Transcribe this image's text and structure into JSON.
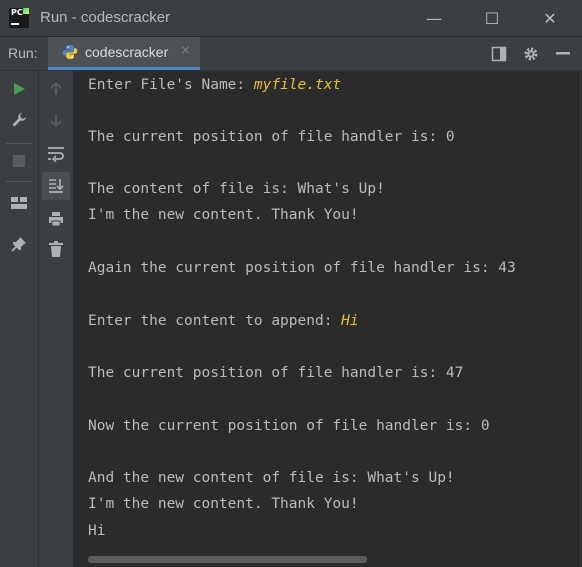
{
  "window": {
    "title": "Run - codescracker",
    "minimize": "—",
    "maximize": "☐",
    "close": "✕"
  },
  "runbar": {
    "label": "Run:",
    "tab_label": "codescracker",
    "tab_close": "×"
  },
  "console": {
    "lines": [
      {
        "text": "Enter File's Name: ",
        "input": "myfile.txt"
      },
      {
        "text": "The current position of file handler is: 0"
      },
      {
        "text": "The content of file is: What's Up!"
      },
      {
        "text": "I'm the new content. Thank You!"
      },
      {
        "text": "Again the current position of file handler is: 43"
      },
      {
        "text": "Enter the content to append: ",
        "input": "Hi"
      },
      {
        "text": "The current position of file handler is: 47"
      },
      {
        "text": "Now the current position of file handler is: 0"
      },
      {
        "text": "And the new content of file is: What's Up!"
      },
      {
        "text": "I'm the new content. Thank You!"
      },
      {
        "text": "Hi"
      }
    ]
  },
  "colors": {
    "console_bg": "#2b2b2b",
    "panel_bg": "#3c3f41",
    "text": "#bbbbbb",
    "input_text": "#e8bf35",
    "run_green": "#499c54",
    "tab_underline": "#4a88c7"
  }
}
